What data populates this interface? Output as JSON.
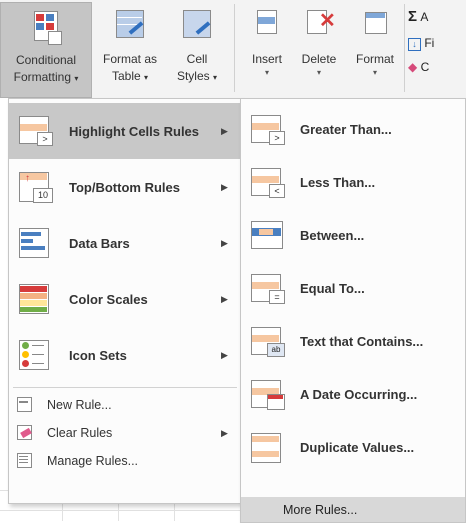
{
  "ribbon": {
    "buttons": [
      {
        "line1": "Conditional",
        "line2": "Formatting",
        "active": true
      },
      {
        "line1": "Format as",
        "line2": "Table"
      },
      {
        "line1": "Cell",
        "line2": "Styles"
      },
      {
        "line1": "Insert",
        "line2": ""
      },
      {
        "line1": "Delete",
        "line2": ""
      },
      {
        "line1": "Format",
        "line2": ""
      }
    ],
    "editing": {
      "sum_label": "A",
      "fill_label": "Fi",
      "clear_label": "C"
    }
  },
  "menu": {
    "items": [
      {
        "label": "Highlight Cells Rules",
        "has_submenu": true,
        "highlighted": true
      },
      {
        "label": "Top/Bottom Rules",
        "has_submenu": true
      },
      {
        "label": "Data Bars",
        "has_submenu": true
      },
      {
        "label": "Color Scales",
        "has_submenu": true
      },
      {
        "label": "Icon Sets",
        "has_submenu": true
      }
    ],
    "small_items": [
      {
        "label": "New Rule..."
      },
      {
        "label": "Clear Rules",
        "has_submenu": true
      },
      {
        "label": "Manage Rules..."
      }
    ]
  },
  "submenu": {
    "items": [
      {
        "label": "Greater Than..."
      },
      {
        "label": "Less Than..."
      },
      {
        "label": "Between..."
      },
      {
        "label": "Equal To..."
      },
      {
        "label": "Text that Contains..."
      },
      {
        "label": "A Date Occurring..."
      },
      {
        "label": "Duplicate Values..."
      }
    ],
    "more_rules": "More Rules..."
  },
  "icons": {
    "greater_than": ">",
    "less_than": "<",
    "equal_to": "=",
    "text_contains": "ab",
    "top_bottom": "10"
  },
  "colors": {
    "highlight_fill": "#f6c7a1",
    "accent_orange": "#e6a25c",
    "accent_blue": "#4a7fc0",
    "accent_green": "#70ad47",
    "accent_red": "#d63b3b",
    "selection_gray": "#c8c8c8"
  }
}
